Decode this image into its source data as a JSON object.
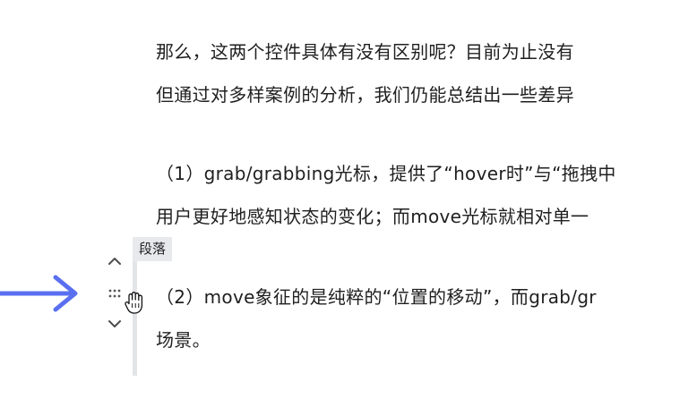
{
  "document": {
    "paragraphs": [
      {
        "lines": [
          "那么，这两个控件具体有没有区别呢？目前为止没有",
          "但通过对多样案例的分析，我们仍能总结出一些差异"
        ]
      },
      {
        "lines": [
          "（1）grab/grabbing光标，提供了“hover时”与“拖拽中",
          "用户更好地感知状态的变化；而move光标就相对单一"
        ]
      },
      {
        "lines": [
          "（2）move象征的是纯粹的“位置的移动”，而grab/gr",
          "场景。"
        ]
      }
    ]
  },
  "block_toolbar": {
    "type_label": "段落",
    "move_up_icon": "chevron-up-icon",
    "drag_icon": "drag-handle-dots-icon",
    "move_down_icon": "chevron-down-icon"
  },
  "annotation": {
    "arrow_icon": "right-arrow-icon",
    "arrow_color": "#5a6ff0"
  },
  "cursor": {
    "icon": "grab-hand-cursor-icon"
  }
}
